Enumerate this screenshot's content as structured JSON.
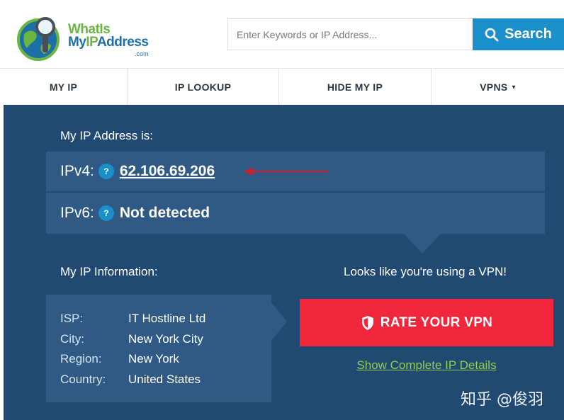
{
  "header": {
    "logo": {
      "line1": "WhatIs",
      "line2_a": "My",
      "line2_b": "IP",
      "line2_c": "Address",
      "suffix": ".com"
    },
    "search": {
      "placeholder": "Enter Keywords or IP Address...",
      "value": "",
      "button_label": "Search"
    }
  },
  "nav": {
    "items": [
      {
        "label": "MY IP"
      },
      {
        "label": "IP LOOKUP"
      },
      {
        "label": "HIDE MY IP"
      },
      {
        "label": "VPNS",
        "dropdown_glyph": "▾"
      }
    ]
  },
  "main": {
    "address_heading": "My IP Address is:",
    "ipv4_label": "IPv4:",
    "ipv4_value": "62.106.69.206",
    "ipv6_label": "IPv6:",
    "ipv6_value": "Not detected",
    "help_glyph": "?",
    "info_heading": "My IP Information:",
    "info": [
      {
        "key": "ISP:",
        "value": "IT Hostline Ltd"
      },
      {
        "key": "City:",
        "value": "New York City"
      },
      {
        "key": "Region:",
        "value": "New York"
      },
      {
        "key": "Country:",
        "value": "United States"
      }
    ],
    "vpn_notice": "Looks like you're using a VPN!",
    "rate_button_label": "RATE YOUR VPN",
    "details_link": "Show Complete IP Details",
    "watermark": "知乎 @俊羽"
  },
  "colors": {
    "panel": "#214a73",
    "row": "#2e5a85",
    "accent_blue": "#1a8fc9",
    "rate_red": "#f0263a",
    "link_green": "#8ecf4f",
    "annotation_arrow": "#d21e26"
  },
  "icons": {
    "logo": "globe-magnifier-icon",
    "search": "search-icon",
    "rate": "shield-icon",
    "annotation": "red-arrow-annotation"
  }
}
